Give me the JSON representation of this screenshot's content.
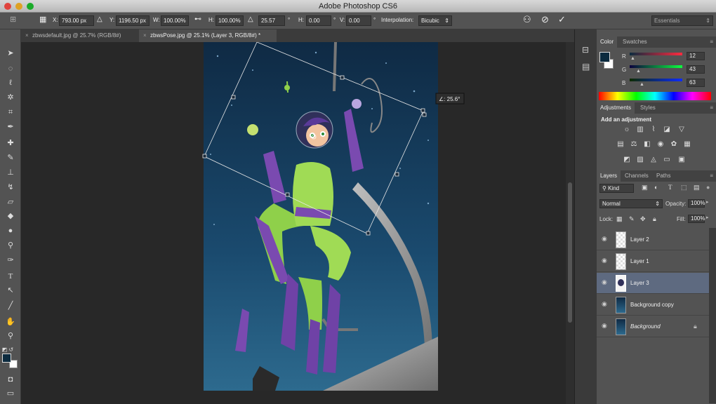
{
  "window": {
    "title": "Adobe Photoshop CS6"
  },
  "options_bar": {
    "x_label": "X:",
    "x_value": "793.00 px",
    "y_label": "Y:",
    "y_value": "1196.50 px",
    "w_label": "W:",
    "w_value": "100.00%",
    "h_label": "H:",
    "h_value": "100.00%",
    "angle_value": "25.57",
    "degree": "°",
    "hskew_label": "H:",
    "hskew_value": "0.00",
    "vskew_label": "V:",
    "vskew_value": "0.00",
    "interp_label": "Interpolation:",
    "interp_value": "Bicubic",
    "workspace": "Essentials"
  },
  "doc_tabs": [
    {
      "label": "zbwsdefault.jpg @ 25.7% (RGB/8#)"
    },
    {
      "label": "zbwsPose.jpg @ 25.1% (Layer 3, RGB/8#) *"
    }
  ],
  "canvas": {
    "angle_readout": "∠: 25.6°"
  },
  "color_panel": {
    "tabs": [
      "Color",
      "Swatches"
    ],
    "r_label": "R",
    "r": "12",
    "g_label": "G",
    "g": "43",
    "b_label": "B",
    "b": "63",
    "fg_color": "#0c2b3f"
  },
  "adjustments_panel": {
    "tabs": [
      "Adjustments",
      "Styles"
    ],
    "heading": "Add an adjustment"
  },
  "layers_panel": {
    "tabs": [
      "Layers",
      "Channels",
      "Paths"
    ],
    "filter": "Kind",
    "blend_mode": "Normal",
    "opacity_label": "Opacity:",
    "opacity": "100%",
    "lock_label": "Lock:",
    "fill_label": "Fill:",
    "fill": "100%",
    "layers": [
      {
        "name": "Layer 2"
      },
      {
        "name": "Layer 1"
      },
      {
        "name": "Layer 3"
      },
      {
        "name": "Background copy"
      },
      {
        "name": "Background"
      }
    ]
  }
}
